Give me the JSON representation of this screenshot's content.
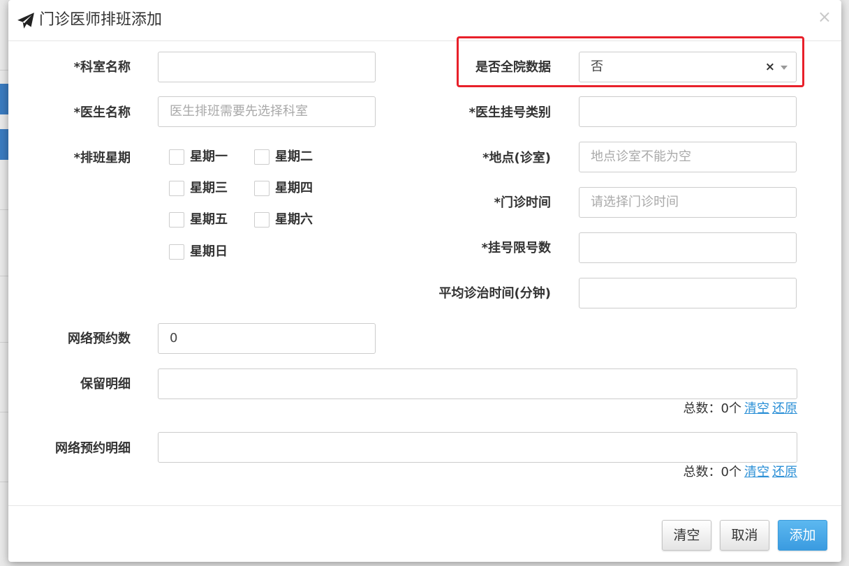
{
  "dialog": {
    "title": "门诊医师排班添加",
    "close_glyph": "×",
    "title_icon": "paper-plane-icon"
  },
  "form": {
    "dept_name": {
      "label": "*科室名称",
      "value": "",
      "placeholder": ""
    },
    "doctor_name": {
      "label": "*医生名称",
      "value": "",
      "placeholder": "医生排班需要先选择科室"
    },
    "schedule_week": {
      "label": "*排班星期",
      "days": [
        {
          "label": "星期一",
          "checked": false
        },
        {
          "label": "星期二",
          "checked": false
        },
        {
          "label": "星期三",
          "checked": false
        },
        {
          "label": "星期四",
          "checked": false
        },
        {
          "label": "星期五",
          "checked": false
        },
        {
          "label": "星期六",
          "checked": false
        },
        {
          "label": "星期日",
          "checked": false
        }
      ]
    },
    "hospital_wide": {
      "label": "是否全院数据",
      "value": "否",
      "clear_glyph": "×"
    },
    "register_type": {
      "label": "*医生挂号类别",
      "value": "",
      "placeholder": ""
    },
    "location": {
      "label": "*地点(诊室)",
      "value": "",
      "placeholder": "地点诊室不能为空"
    },
    "clinic_time": {
      "label": "*门诊时间",
      "value": "",
      "placeholder": "请选择门诊时间"
    },
    "register_limit": {
      "label": "*挂号限号数",
      "value": "",
      "placeholder": ""
    },
    "avg_time": {
      "label": "平均诊治时间(分钟)",
      "value": "",
      "placeholder": ""
    },
    "online_count": {
      "label": "网络预约数",
      "value": "0"
    },
    "reserve_detail": {
      "label": "保留明细",
      "total_text": "总数：0个",
      "clear_link": "清空",
      "restore_link": "还原"
    },
    "online_detail": {
      "label": "网络预约明细",
      "total_text": "总数：0个",
      "clear_link": "清空",
      "restore_link": "还原"
    }
  },
  "buttons": {
    "clear": "清空",
    "cancel": "取消",
    "add": "添加"
  },
  "colors": {
    "highlight_box": "#e8202a",
    "primary_button": "#3a9be0",
    "link": "#2a8fd6"
  }
}
